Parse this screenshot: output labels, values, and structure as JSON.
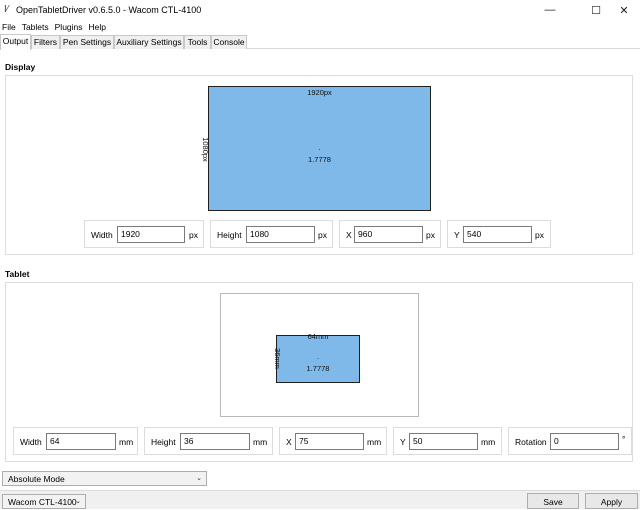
{
  "window": {
    "title": "OpenTabletDriver v0.6.5.0 - Wacom CTL-4100",
    "minimize": "—",
    "maximize": "☐",
    "close": "✕"
  },
  "menu": [
    "File",
    "Tablets",
    "Plugins",
    "Help"
  ],
  "tabs": [
    {
      "label": "Output",
      "active": true
    },
    {
      "label": "Filters",
      "active": false
    },
    {
      "label": "Pen Settings",
      "active": false
    },
    {
      "label": "Auxiliary Settings",
      "active": false
    },
    {
      "label": "Tools",
      "active": false
    },
    {
      "label": "Console",
      "active": false
    }
  ],
  "display": {
    "heading": "Display",
    "area": {
      "width_label": "1920px",
      "height_label": "1080px",
      "ratio": "1.7778",
      "dot": "."
    },
    "fields": [
      {
        "label": "Width",
        "value": "1920",
        "unit": "px"
      },
      {
        "label": "Height",
        "value": "1080",
        "unit": "px"
      },
      {
        "label": "X",
        "value": "960",
        "unit": "px"
      },
      {
        "label": "Y",
        "value": "540",
        "unit": "px"
      }
    ]
  },
  "tablet": {
    "heading": "Tablet",
    "area": {
      "width_label": "64mm",
      "height_label": "36mm",
      "ratio": "1.7778",
      "dot": "."
    },
    "fields": [
      {
        "label": "Width",
        "value": "64",
        "unit": "mm"
      },
      {
        "label": "Height",
        "value": "36",
        "unit": "mm"
      },
      {
        "label": "X",
        "value": "75",
        "unit": "mm"
      },
      {
        "label": "Y",
        "value": "50",
        "unit": "mm"
      },
      {
        "label": "Rotation",
        "value": "0",
        "unit": "°"
      }
    ]
  },
  "output_mode": {
    "selected": "Absolute Mode",
    "arrow": "⌄"
  },
  "footer": {
    "tablet_select": "Wacom CTL-4100",
    "arrow": "⌄",
    "save_label": "Save",
    "apply_label": "Apply"
  },
  "colors": {
    "area_fill": "#7fb9ea",
    "frame_border": "#dcdcdc"
  }
}
